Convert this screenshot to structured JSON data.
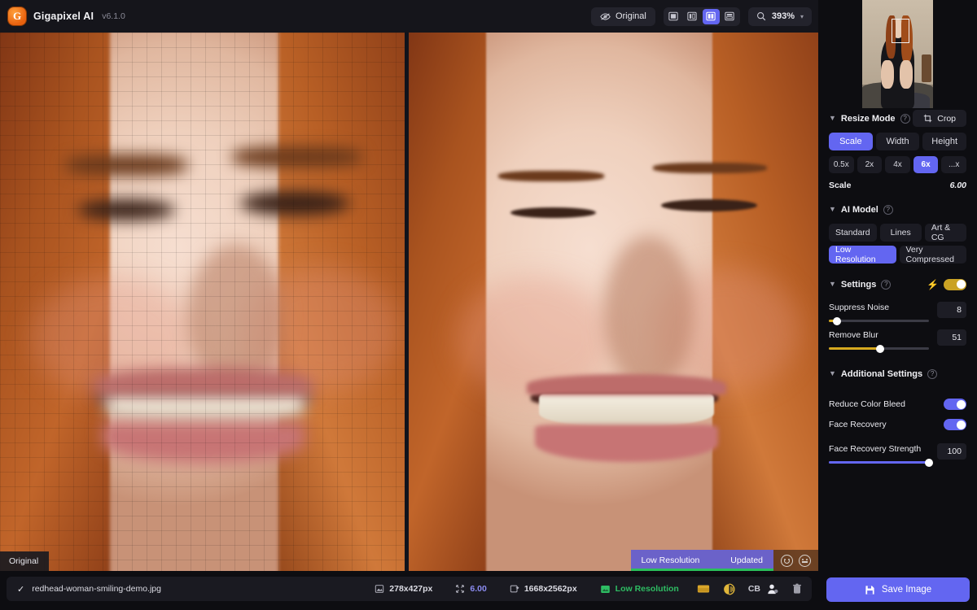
{
  "app": {
    "name": "Gigapixel AI",
    "version": "v6.1.0",
    "logo_letter": "G",
    "accent": "#6366f1",
    "gold": "#d6a91f",
    "green": "#2ebd63"
  },
  "toolbar": {
    "original_button": "Original",
    "original_icon": "eye-slash-icon",
    "view_modes": [
      {
        "name": "single-view",
        "icon": "single-pane-icon",
        "active": false
      },
      {
        "name": "split-vertical-view",
        "icon": "split-vertical-icon",
        "active": false
      },
      {
        "name": "side-by-side-view",
        "icon": "side-by-side-icon",
        "active": true
      },
      {
        "name": "split-horizontal-view",
        "icon": "split-horizontal-icon",
        "active": false
      }
    ],
    "zoom_icon": "magnifier-icon",
    "zoom_level": "393%",
    "zoom_caret": "▾"
  },
  "viewport": {
    "left_label": "Original",
    "badge_model": "Low Resolution",
    "badge_status": "Updated",
    "feedback_icons": [
      "smiley-face-icon",
      "neutral-face-icon"
    ]
  },
  "sidebar": {
    "thumbnail": {
      "name": "image-thumbnail",
      "viewport_rect": true
    },
    "resize_mode": {
      "title": "Resize Mode",
      "help": "?",
      "crop_label": "Crop",
      "crop_icon": "crop-icon",
      "tabs": [
        {
          "label": "Scale",
          "active": true
        },
        {
          "label": "Width",
          "active": false
        },
        {
          "label": "Height",
          "active": false
        }
      ],
      "scale_presets": [
        {
          "label": "0.5x",
          "active": false
        },
        {
          "label": "2x",
          "active": false
        },
        {
          "label": "4x",
          "active": false
        },
        {
          "label": "6x",
          "active": true
        },
        {
          "label": "...x",
          "active": false
        }
      ],
      "scale_key": "Scale",
      "scale_value": "6.00"
    },
    "ai_model": {
      "title": "AI Model",
      "help": "?",
      "row1": [
        {
          "label": "Standard",
          "active": false
        },
        {
          "label": "Lines",
          "active": false
        },
        {
          "label": "Art & CG",
          "active": false
        }
      ],
      "row2": [
        {
          "label": "Low Resolution",
          "active": true
        },
        {
          "label": "Very Compressed",
          "active": false
        }
      ]
    },
    "settings": {
      "title": "Settings",
      "help": "?",
      "auto_icon": "lightning-bolt-icon",
      "auto_toggle_on": true,
      "sliders": [
        {
          "label": "Suppress Noise",
          "value": "8",
          "percent": 8
        },
        {
          "label": "Remove Blur",
          "value": "51",
          "percent": 51
        }
      ]
    },
    "additional_settings": {
      "title": "Additional Settings",
      "help": "?",
      "toggles": [
        {
          "label": "Reduce Color Bleed",
          "on": true
        },
        {
          "label": "Face Recovery",
          "on": true
        }
      ],
      "slider": {
        "label": "Face Recovery Strength",
        "value": "100",
        "percent": 100
      }
    },
    "save_button": {
      "label": "Save Image",
      "icon": "save-disk-icon"
    }
  },
  "statusbar": {
    "check_icon": "✓",
    "filename": "redhead-woman-smiling-demo.jpg",
    "source_icon": "image-size-icon",
    "source_size": "278x427px",
    "scale_icon": "resize-arrows-icon",
    "scale_value": "6.00",
    "output_icon": "export-size-icon",
    "output_size": "1668x2562px",
    "model_icon": "model-chip-icon",
    "model_name": "Low Resolution",
    "extra_icons": [
      {
        "name": "color-swatch-icon",
        "glyph": ""
      },
      {
        "name": "contrast-split-icon",
        "glyph": ""
      },
      {
        "name": "cb-label",
        "glyph": "CB"
      },
      {
        "name": "face-person-icon",
        "glyph": ""
      },
      {
        "name": "trash-icon",
        "glyph": ""
      }
    ]
  }
}
